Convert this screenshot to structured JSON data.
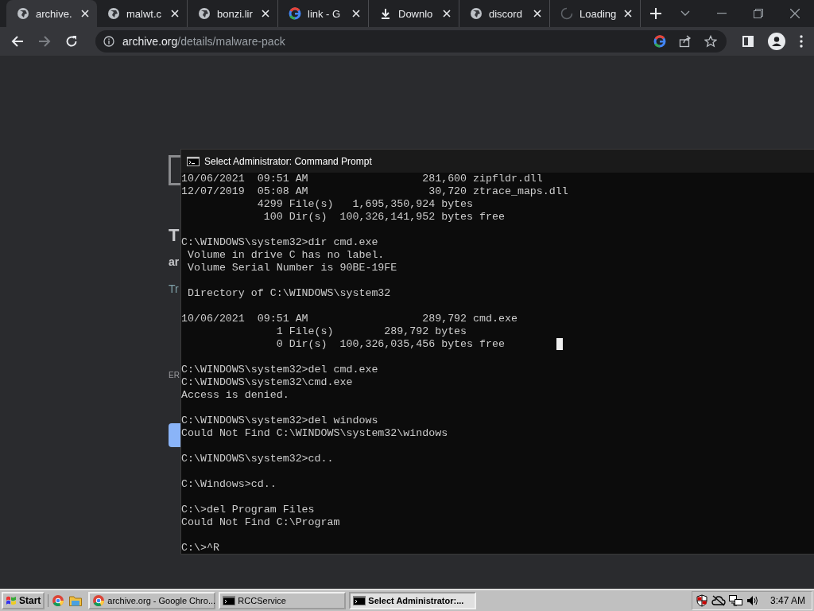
{
  "browser": {
    "tabs": [
      {
        "label": "archive.",
        "kind": "globe",
        "selected": true
      },
      {
        "label": "malwt.c",
        "kind": "globe",
        "selected": false
      },
      {
        "label": "bonzi.lir",
        "kind": "globe",
        "selected": false
      },
      {
        "label": "link - G",
        "kind": "google",
        "selected": false
      },
      {
        "label": "Downlo",
        "kind": "download",
        "selected": false
      },
      {
        "label": "discord",
        "kind": "globe",
        "selected": false
      },
      {
        "label": "Loading",
        "kind": "spinner",
        "selected": false
      }
    ],
    "address": {
      "host": "archive.org",
      "path": "/details/malware-pack"
    }
  },
  "page": {
    "heading": "T",
    "subtitle": "ar",
    "hint": "Tr",
    "note": "ER"
  },
  "console": {
    "title": "Select Administrator: Command Prompt",
    "blocks": [
      [
        "10/06/2021  09:51 AM                  281,600 zipfldr.dll",
        "12/07/2019  05:08 AM                   30,720 ztrace_maps.dll",
        "            4299 File(s)   1,695,350,924 bytes",
        "             100 Dir(s)  100,326,141,952 bytes free"
      ],
      [
        "C:\\WINDOWS\\system32>dir cmd.exe",
        " Volume in drive C has no label.",
        " Volume Serial Number is 90BE-19FE"
      ],
      [
        " Directory of C:\\WINDOWS\\system32"
      ],
      [
        "10/06/2021  09:51 AM                  289,792 cmd.exe",
        "               1 File(s)        289,792 bytes",
        "               0 Dir(s)  100,326,035,456 bytes free"
      ],
      [
        "C:\\WINDOWS\\system32>del cmd.exe",
        "C:\\WINDOWS\\system32\\cmd.exe",
        "Access is denied."
      ],
      [
        "C:\\WINDOWS\\system32>del windows",
        "Could Not Find C:\\WINDOWS\\system32\\windows"
      ],
      [
        "C:\\WINDOWS\\system32>cd.."
      ],
      [
        "C:\\Windows>cd.."
      ],
      [
        "C:\\>del Program Files",
        "Could Not Find C:\\Program"
      ],
      [
        "C:\\>^R"
      ]
    ]
  },
  "taskbar": {
    "start": "Start",
    "tasks": [
      {
        "label": "archive.org - Google Chro...",
        "kind": "chrome",
        "selected": false
      },
      {
        "label": "RCCService",
        "kind": "console",
        "selected": false
      },
      {
        "label": "Select Administrator:...",
        "kind": "console",
        "selected": true
      }
    ],
    "clock": "3:47 AM"
  }
}
